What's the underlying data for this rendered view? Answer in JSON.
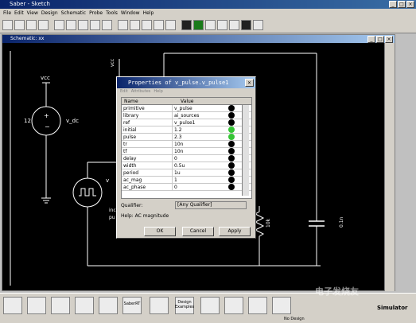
{
  "app": {
    "title": "Saber - Sketch",
    "menu": [
      "File",
      "Edit",
      "View",
      "Design",
      "Schematic",
      "Probe",
      "Tools",
      "Window",
      "Help"
    ]
  },
  "schematic": {
    "title": "Schematic: xx",
    "labels": {
      "vcc_top": "vcc",
      "vcc_source": "vcc",
      "v_dc": "v_dc",
      "v_dc_value": "12",
      "v_pulse": "v",
      "inc": "inc",
      "pu": "pu",
      "r_label": "10k",
      "c_label": "0.1n"
    }
  },
  "dialog": {
    "title": "Properties of v_pulse.v_pulse1",
    "menu": [
      "Edit",
      "Attributes",
      "Help"
    ],
    "columns": {
      "name": "Name",
      "value": "Value"
    },
    "rows": [
      {
        "name": "primitive",
        "value": "v_pulse",
        "status": "black"
      },
      {
        "name": "library",
        "value": "ai_sources",
        "status": "black"
      },
      {
        "name": "ref",
        "value": "v_pulse1",
        "status": "black"
      },
      {
        "name": "initial",
        "value": "1.2",
        "status": "green"
      },
      {
        "name": "pulse",
        "value": "2.3",
        "status": "green"
      },
      {
        "name": "tr",
        "value": "10n",
        "status": "black"
      },
      {
        "name": "tf",
        "value": "10n",
        "status": "black"
      },
      {
        "name": "delay",
        "value": "0",
        "status": "black"
      },
      {
        "name": "width",
        "value": "0.5u",
        "status": "black"
      },
      {
        "name": "period",
        "value": "1u",
        "status": "black"
      },
      {
        "name": "ac_mag",
        "value": "1",
        "status": "black"
      },
      {
        "name": "ac_phase",
        "value": "0",
        "status": "black"
      }
    ],
    "qualifier_label": "Qualifier:",
    "qualifier_value": "[Any Qualifier]",
    "help": "Help: AC magnitude",
    "buttons": {
      "ok": "OK",
      "cancel": "Cancel",
      "apply": "Apply"
    }
  },
  "bottom": {
    "saber_rt": "SaberRT",
    "design_examples": "Design Examples",
    "simulator": "Simulator",
    "status": "No Design"
  },
  "watermark": "电子发烧友"
}
